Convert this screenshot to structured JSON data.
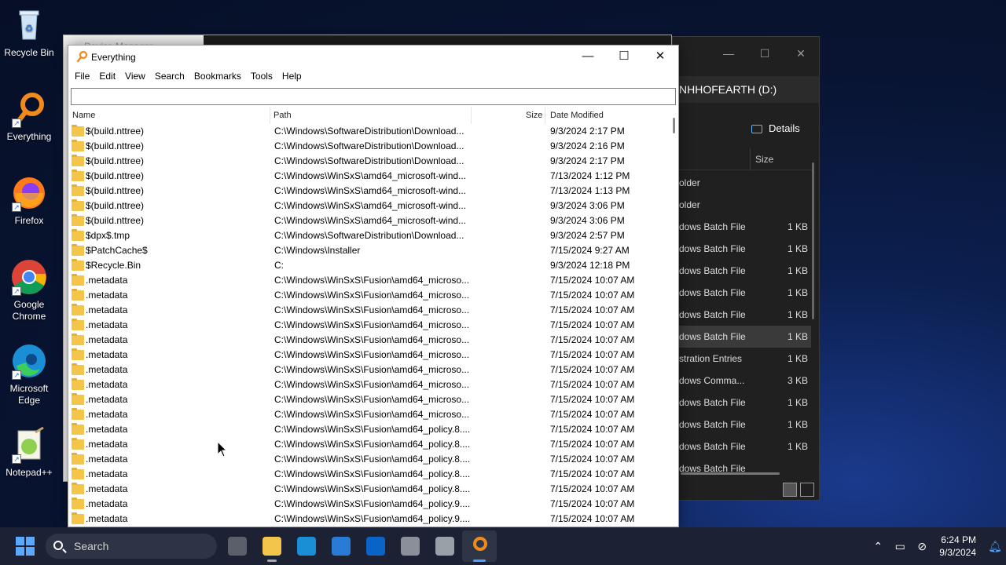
{
  "desktop": {
    "icons": [
      {
        "label": "Recycle Bin"
      },
      {
        "label": "Everything"
      },
      {
        "label": "Firefox"
      },
      {
        "label": "Google Chrome"
      },
      {
        "label": "Microsoft Edge"
      },
      {
        "label": "Notepad++"
      }
    ]
  },
  "background_window": {
    "title_partial": "Device Manager",
    "explorer": {
      "address": "NHHOFEARTH (D:)",
      "details_label": "Details",
      "size_header": "Size",
      "rows": [
        {
          "type": "older",
          "size": ""
        },
        {
          "type": "older",
          "size": ""
        },
        {
          "type": "dows Batch File",
          "size": "1 KB"
        },
        {
          "type": "dows Batch File",
          "size": "1 KB"
        },
        {
          "type": "dows Batch File",
          "size": "1 KB"
        },
        {
          "type": "dows Batch File",
          "size": "1 KB"
        },
        {
          "type": "dows Batch File",
          "size": "1 KB"
        },
        {
          "type": "dows Batch File",
          "size": "1 KB"
        },
        {
          "type": "stration Entries",
          "size": "1 KB"
        },
        {
          "type": "dows Comma...",
          "size": "3 KB"
        },
        {
          "type": "dows Batch File",
          "size": "1 KB"
        },
        {
          "type": "dows Batch File",
          "size": "1 KB"
        },
        {
          "type": "dows Batch File",
          "size": "1 KB"
        },
        {
          "type": "dows Batch File",
          "size": ""
        }
      ]
    }
  },
  "everything": {
    "title": "Everything",
    "menu": [
      "File",
      "Edit",
      "View",
      "Search",
      "Bookmarks",
      "Tools",
      "Help"
    ],
    "search_value": "",
    "columns": {
      "name": "Name",
      "path": "Path",
      "size": "Size",
      "date": "Date Modified"
    },
    "rows": [
      {
        "name": "$(build.nttree)",
        "path": "C:\\Windows\\SoftwareDistribution\\Download...",
        "date": "9/3/2024 2:17 PM"
      },
      {
        "name": "$(build.nttree)",
        "path": "C:\\Windows\\SoftwareDistribution\\Download...",
        "date": "9/3/2024 2:16 PM"
      },
      {
        "name": "$(build.nttree)",
        "path": "C:\\Windows\\SoftwareDistribution\\Download...",
        "date": "9/3/2024 2:17 PM"
      },
      {
        "name": "$(build.nttree)",
        "path": "C:\\Windows\\WinSxS\\amd64_microsoft-wind...",
        "date": "7/13/2024 1:12 PM"
      },
      {
        "name": "$(build.nttree)",
        "path": "C:\\Windows\\WinSxS\\amd64_microsoft-wind...",
        "date": "7/13/2024 1:13 PM"
      },
      {
        "name": "$(build.nttree)",
        "path": "C:\\Windows\\WinSxS\\amd64_microsoft-wind...",
        "date": "9/3/2024 3:06 PM"
      },
      {
        "name": "$(build.nttree)",
        "path": "C:\\Windows\\WinSxS\\amd64_microsoft-wind...",
        "date": "9/3/2024 3:06 PM"
      },
      {
        "name": "$dpx$.tmp",
        "path": "C:\\Windows\\SoftwareDistribution\\Download...",
        "date": "9/3/2024 2:57 PM"
      },
      {
        "name": "$PatchCache$",
        "path": "C:\\Windows\\Installer",
        "date": "7/15/2024 9:27 AM"
      },
      {
        "name": "$Recycle.Bin",
        "path": "C:",
        "date": "9/3/2024 12:18 PM"
      },
      {
        "name": ".metadata",
        "path": "C:\\Windows\\WinSxS\\Fusion\\amd64_microso...",
        "date": "7/15/2024 10:07 AM"
      },
      {
        "name": ".metadata",
        "path": "C:\\Windows\\WinSxS\\Fusion\\amd64_microso...",
        "date": "7/15/2024 10:07 AM"
      },
      {
        "name": ".metadata",
        "path": "C:\\Windows\\WinSxS\\Fusion\\amd64_microso...",
        "date": "7/15/2024 10:07 AM"
      },
      {
        "name": ".metadata",
        "path": "C:\\Windows\\WinSxS\\Fusion\\amd64_microso...",
        "date": "7/15/2024 10:07 AM"
      },
      {
        "name": ".metadata",
        "path": "C:\\Windows\\WinSxS\\Fusion\\amd64_microso...",
        "date": "7/15/2024 10:07 AM"
      },
      {
        "name": ".metadata",
        "path": "C:\\Windows\\WinSxS\\Fusion\\amd64_microso...",
        "date": "7/15/2024 10:07 AM"
      },
      {
        "name": ".metadata",
        "path": "C:\\Windows\\WinSxS\\Fusion\\amd64_microso...",
        "date": "7/15/2024 10:07 AM"
      },
      {
        "name": ".metadata",
        "path": "C:\\Windows\\WinSxS\\Fusion\\amd64_microso...",
        "date": "7/15/2024 10:07 AM"
      },
      {
        "name": ".metadata",
        "path": "C:\\Windows\\WinSxS\\Fusion\\amd64_microso...",
        "date": "7/15/2024 10:07 AM"
      },
      {
        "name": ".metadata",
        "path": "C:\\Windows\\WinSxS\\Fusion\\amd64_microso...",
        "date": "7/15/2024 10:07 AM"
      },
      {
        "name": ".metadata",
        "path": "C:\\Windows\\WinSxS\\Fusion\\amd64_policy.8....",
        "date": "7/15/2024 10:07 AM"
      },
      {
        "name": ".metadata",
        "path": "C:\\Windows\\WinSxS\\Fusion\\amd64_policy.8....",
        "date": "7/15/2024 10:07 AM"
      },
      {
        "name": ".metadata",
        "path": "C:\\Windows\\WinSxS\\Fusion\\amd64_policy.8....",
        "date": "7/15/2024 10:07 AM"
      },
      {
        "name": ".metadata",
        "path": "C:\\Windows\\WinSxS\\Fusion\\amd64_policy.8....",
        "date": "7/15/2024 10:07 AM"
      },
      {
        "name": ".metadata",
        "path": "C:\\Windows\\WinSxS\\Fusion\\amd64_policy.8....",
        "date": "7/15/2024 10:07 AM"
      },
      {
        "name": ".metadata",
        "path": "C:\\Windows\\WinSxS\\Fusion\\amd64_policy.9....",
        "date": "7/15/2024 10:07 AM"
      },
      {
        "name": ".metadata",
        "path": "C:\\Windows\\WinSxS\\Fusion\\amd64_policy.9....",
        "date": "7/15/2024 10:07 AM"
      }
    ]
  },
  "taskbar": {
    "search_placeholder": "Search",
    "apps": [
      "task-view-icon",
      "file-explorer-icon",
      "edge-icon",
      "store-icon",
      "outlook-icon",
      "settings-icon",
      "device-manager-icon",
      "everything-icon"
    ],
    "active_app": "everything-icon",
    "time": "6:24 PM",
    "date": "9/3/2024"
  },
  "colors": {
    "accent": "#4ca2ff",
    "folder": "#f3c54a"
  }
}
